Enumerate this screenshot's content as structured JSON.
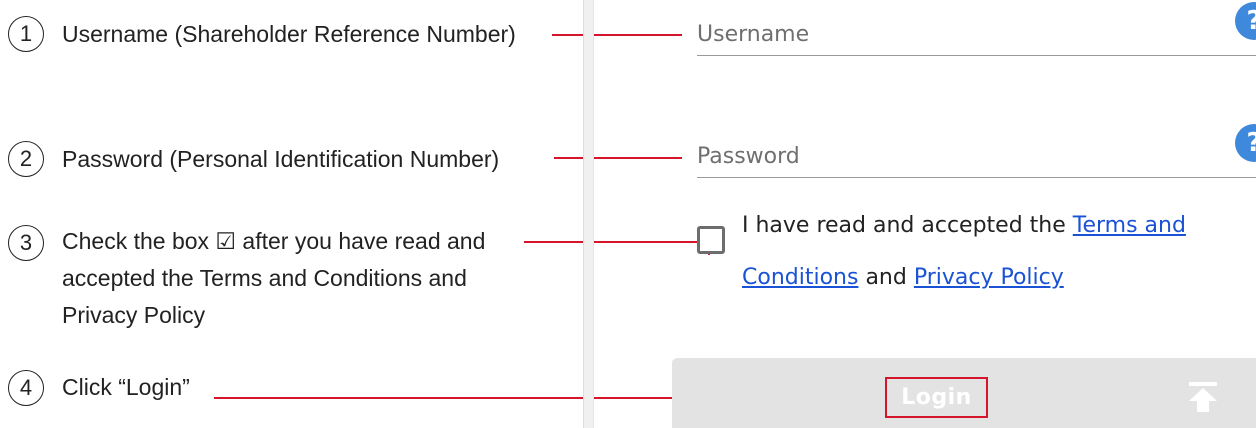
{
  "steps": [
    {
      "num": "1",
      "text": "Username (Shareholder Reference Number)"
    },
    {
      "num": "2",
      "text": "Password (Personal Identification Number)"
    },
    {
      "num": "3",
      "lines": [
        "Check the box ☑ after you have read and",
        "accepted the Terms and Conditions and",
        "Privacy Policy"
      ]
    },
    {
      "num": "4",
      "text": "Click “Login”"
    }
  ],
  "form": {
    "username_placeholder": "Username",
    "password_placeholder": "Password",
    "help_icon_glyph": "?",
    "terms_prefix": "I have read and accepted the ",
    "terms_link": "Terms and Conditions",
    "terms_and": " and ",
    "privacy_link": "Privacy Policy",
    "login_label": "Login",
    "checkbox_checked": false
  },
  "icons": {
    "help": "help-circle-icon",
    "back_to_top": "arrow-up-to-line-icon"
  },
  "colors": {
    "annotation_red": "#d4152b",
    "help_blue": "#3f89dc",
    "link_blue": "#1a52d6",
    "login_bar_gray": "#e3e3e3"
  }
}
